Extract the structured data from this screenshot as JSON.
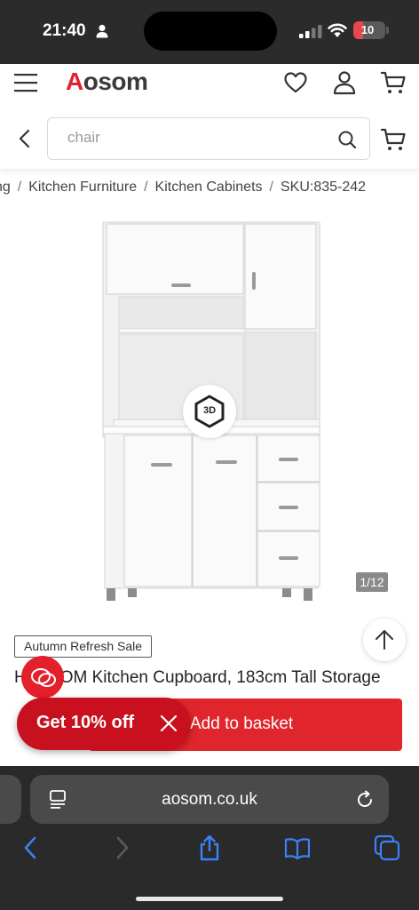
{
  "status_bar": {
    "time": "21:40",
    "battery": "10",
    "battery_level": 0.1
  },
  "header": {
    "logo_first": "A",
    "logo_rest": "osom",
    "icons": [
      "menu-icon",
      "heart-icon",
      "account-icon",
      "cart-icon"
    ]
  },
  "search": {
    "placeholder": "chair",
    "value": ""
  },
  "breadcrumb": {
    "items": [
      "ng",
      "Kitchen Furniture",
      "Kitchen Cabinets",
      "SKU:835-242"
    ],
    "separator": "/"
  },
  "gallery": {
    "counter": "1/12",
    "badge": "3D"
  },
  "product": {
    "sale_tag": "Autumn Refresh Sale",
    "title": "H  OM Kitchen Cupboard, 183cm Tall Storage"
  },
  "cta": {
    "offer_label": "Get 10% off",
    "add_to_basket": "Add to basket"
  },
  "browser": {
    "url": "aosom.co.uk",
    "toolbar_icons": [
      "back-arrow-icon",
      "forward-arrow-icon",
      "share-icon",
      "bookmarks-icon",
      "tabs-icon"
    ]
  },
  "colors": {
    "brand_red": "#e3202b",
    "button_red": "#e0262c",
    "offer_red": "#c8101e",
    "ios_blue": "#3a82f7",
    "safari_bar": "#2a2a2a"
  }
}
